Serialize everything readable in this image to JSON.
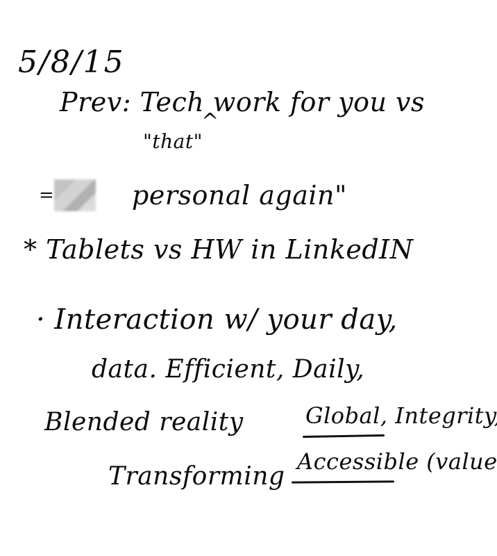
{
  "note": {
    "date": "5/8/15",
    "line_prev": "Prev: Tech work for you vs",
    "insert_that": "\"that\"",
    "insert_caret": "^",
    "line_personal_prefix": "=",
    "line_personal": "personal again\"",
    "line_tablets": "* Tablets vs HW in LinkedIN",
    "line_interaction": "· Interaction w/ your day,",
    "line_data": "data. Efficient, Daily,",
    "line_blended": "Blended reality",
    "line_global": "Global, Integrity,",
    "line_accessible": "Accessible (values)",
    "line_transforming": "Transforming"
  },
  "colors": {
    "ink": "#0b0b0b",
    "paper": "#ffffff",
    "redaction": "#bdbdbd"
  }
}
